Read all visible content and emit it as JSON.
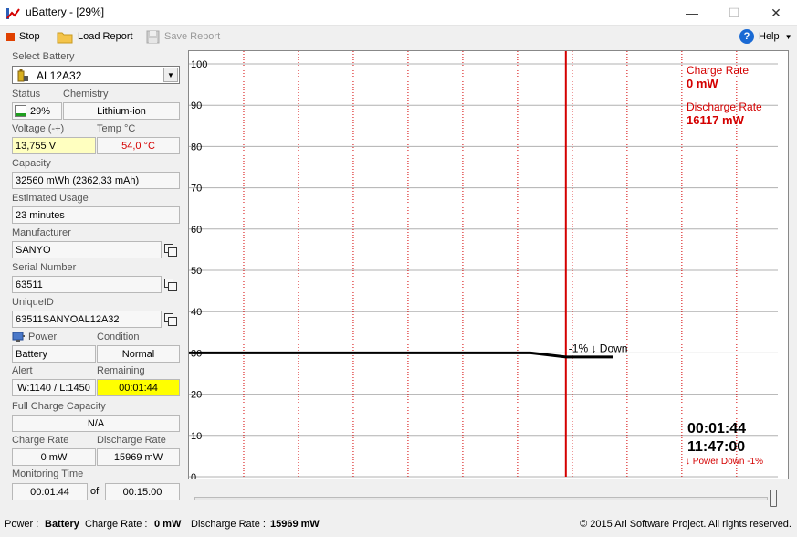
{
  "window": {
    "title": "uBattery - [29%]",
    "minimize": "—",
    "maximize": "☐",
    "close": "✕"
  },
  "toolbar": {
    "stop_label": "Stop",
    "load_report_label": "Load Report",
    "save_report_label": "Save Report",
    "help_label": "Help"
  },
  "battery": {
    "select_label": "Select Battery",
    "selected": "AL12A32",
    "status_label": "Status",
    "chemistry_label": "Chemistry",
    "status_value": "29%",
    "chemistry_value": "Lithium-ion",
    "charge_fraction": 0.29,
    "voltage_label": "Voltage (-+)",
    "temp_label": "Temp °C",
    "voltage_value": "13,755 V",
    "temp_value": "54,0 °C",
    "capacity_label": "Capacity",
    "capacity_value": "32560 mWh (2362,33 mAh)",
    "estimated_usage_label": "Estimated Usage",
    "estimated_usage_value": "23 minutes",
    "manufacturer_label": "Manufacturer",
    "manufacturer_value": "SANYO",
    "serial_label": "Serial Number",
    "serial_value": "63511",
    "uniqueid_label": "UniqueID",
    "uniqueid_value": "63511SANYOAL12A32",
    "power_label": "Power",
    "condition_label": "Condition",
    "power_value": "Battery",
    "condition_value": "Normal",
    "alert_label": "Alert",
    "remaining_label": "Remaining",
    "alert_value": "W:1140 / L:1450",
    "remaining_value": "00:01:44",
    "full_charge_label": "Full Charge Capacity",
    "full_charge_value": "N/A",
    "charge_rate_label": "Charge Rate",
    "discharge_rate_label": "Discharge Rate",
    "charge_rate_value": "0 mW",
    "discharge_rate_value": "15969 mW",
    "monitoring_label": "Monitoring Time",
    "monitoring_elapsed": "00:01:44",
    "monitoring_of": "of",
    "monitoring_total": "00:15:00"
  },
  "chart_data": {
    "type": "line",
    "ylim": [
      0,
      100
    ],
    "yticks": [
      "100",
      "90",
      "80",
      "70",
      "60",
      "50",
      "40",
      "30",
      "20",
      "10",
      "0"
    ],
    "series": [
      {
        "x": [
          0,
          58,
          64,
          72,
          100
        ],
        "values": [
          30,
          30,
          29,
          29,
          null
        ]
      }
    ],
    "series_color": "#000000",
    "marker_x": 64,
    "marker_color": "#d40000",
    "grid_color": "#d40000",
    "annotation": "-1% ↓ Down",
    "charge_rate_title": "Charge Rate",
    "charge_rate_value": "0 mW",
    "discharge_rate_title": "Discharge Rate",
    "discharge_rate_value": "16117 mW",
    "elapsed_time": "00:01:44",
    "clock_time": "11:47:00",
    "power_event": "↓ Power Down -1%"
  },
  "slider": {
    "position_fraction": 1.0
  },
  "statusbar": {
    "power_label": "Power :",
    "power_value": "Battery",
    "charge_rate_label": "Charge Rate :",
    "charge_rate_value": "0 mW",
    "discharge_rate_label": "Discharge Rate :",
    "discharge_rate_value": "15969 mW",
    "copyright": "© 2015 Ari Software Project. All rights reserved."
  },
  "colors": {
    "voltage_bg": "#ffffc0",
    "remaining_bg": "#ffff00",
    "temp_text": "#d40000",
    "rate_text": "#d40000",
    "stop_icon": "#e04000",
    "help_icon": "#1a6ad4"
  },
  "icons": {
    "app": "battery-graph-icon",
    "stop": "stop-icon",
    "load": "folder-icon",
    "save": "floppy-icon",
    "help": "help-icon",
    "battery": "battery-icon",
    "power": "power-plug-icon",
    "copy": "copy-icon"
  }
}
